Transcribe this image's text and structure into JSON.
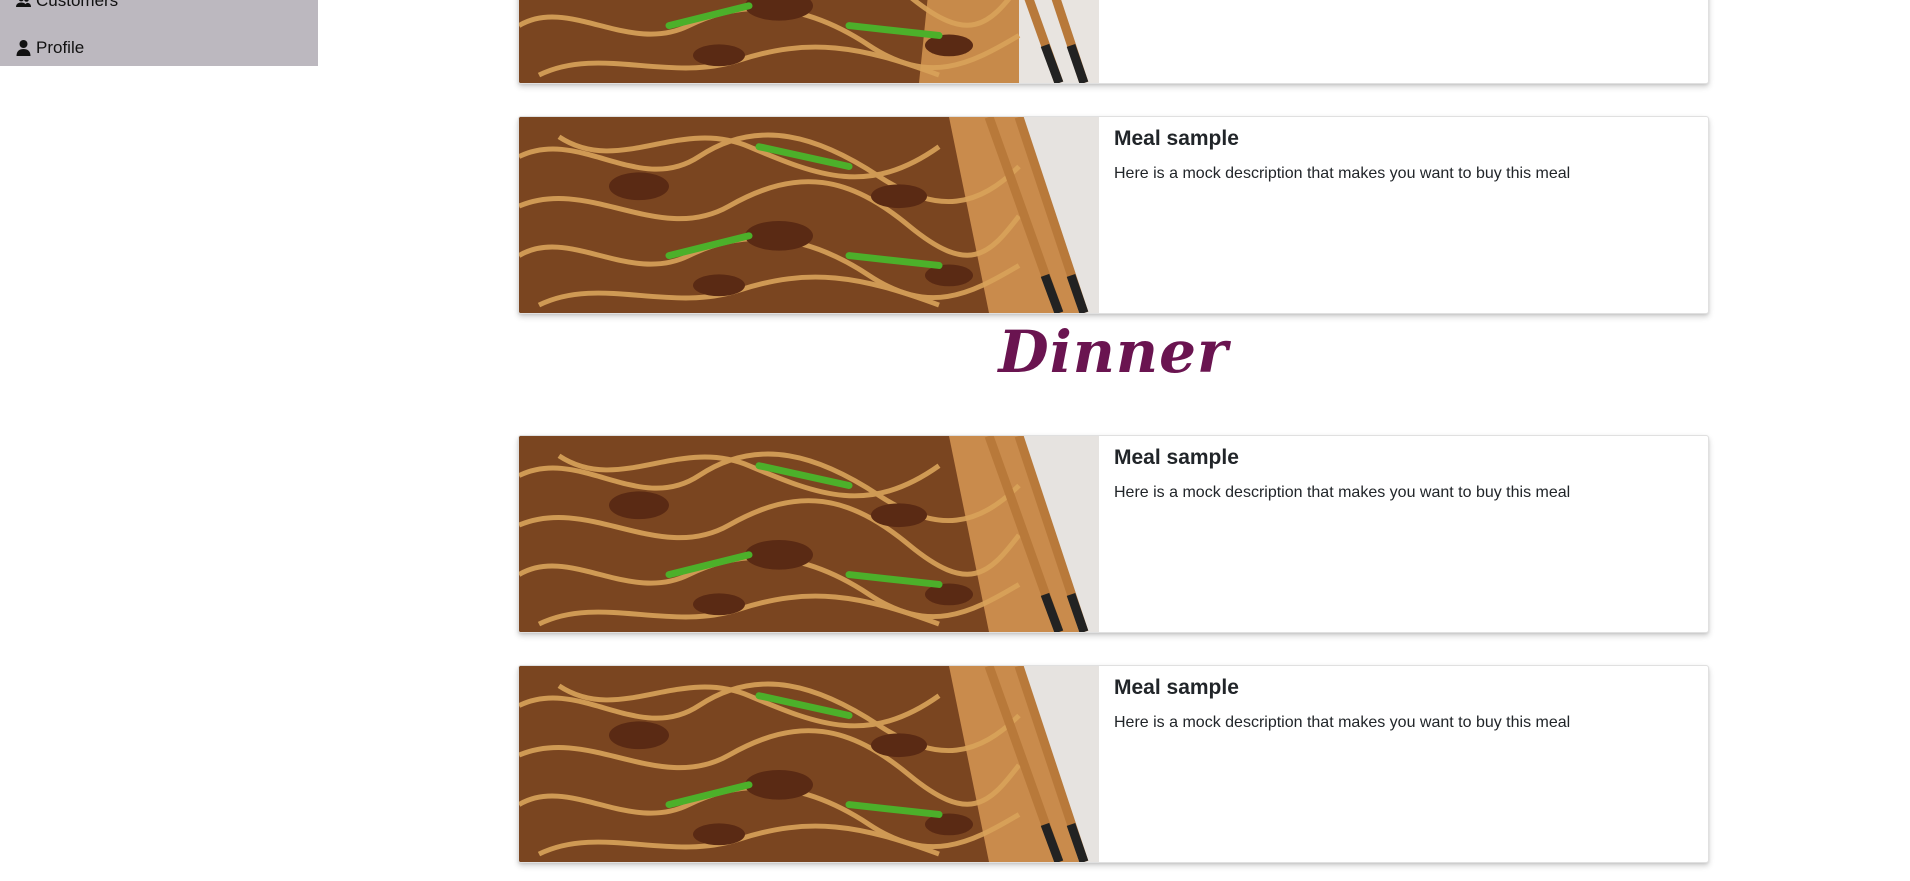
{
  "sidebar": {
    "items": [
      {
        "label": "Customers",
        "icon": "users-icon"
      },
      {
        "label": "Profile",
        "icon": "user-icon"
      }
    ]
  },
  "main": {
    "cards_top": [
      {
        "title": "",
        "description": ""
      },
      {
        "title": "Meal sample",
        "description": "Here is a mock description that makes you want to buy this meal"
      }
    ],
    "section": {
      "title": "Dinner"
    },
    "cards_dinner": [
      {
        "title": "Meal sample",
        "description": "Here is a mock description that makes you want to buy this meal"
      },
      {
        "title": "Meal sample",
        "description": "Here is a mock description that makes you want to buy this meal"
      }
    ]
  },
  "colors": {
    "sidebar_bg": "#bcb8bf",
    "section_title": "#6a1450"
  }
}
